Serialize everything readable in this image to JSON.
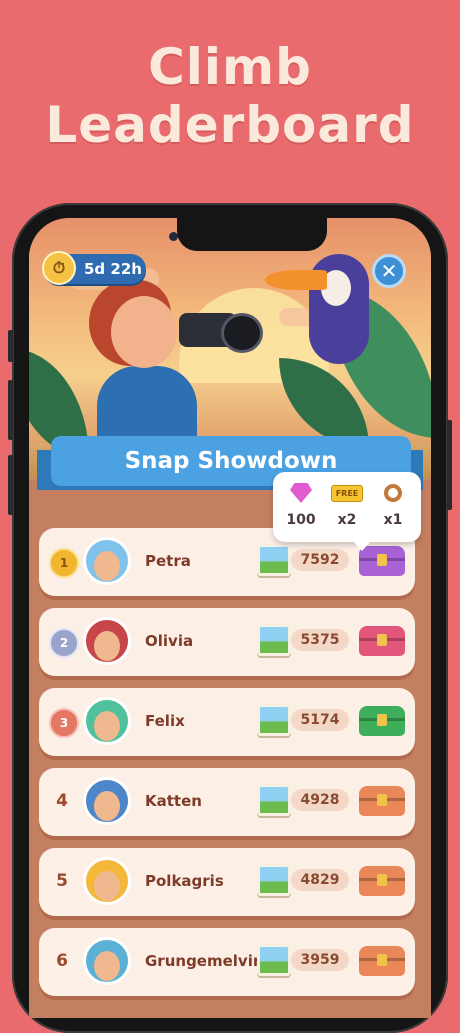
{
  "headline": {
    "line1": "Climb",
    "line2": "Leaderboard"
  },
  "event": {
    "timer": "5d 22h",
    "title": "Snap Showdown",
    "close_label": "✕"
  },
  "rewards": [
    {
      "icon": "gem-icon",
      "value": "100"
    },
    {
      "icon": "free-ticket-icon",
      "badge": "FREE",
      "value": "x2"
    },
    {
      "icon": "ring-icon",
      "value": "x1"
    }
  ],
  "leaderboard": [
    {
      "rank": "1",
      "name": "Petra",
      "score": "7592",
      "medal": "gold",
      "chest": "#a962d6",
      "avatar_bg": "#7fc3ea"
    },
    {
      "rank": "2",
      "name": "Olivia",
      "score": "5375",
      "medal": "silver",
      "chest": "#e2567b",
      "avatar_bg": "#c8454a"
    },
    {
      "rank": "3",
      "name": "Felix",
      "score": "5174",
      "medal": "bronze",
      "chest": "#3fae5a",
      "avatar_bg": "#4fc19c"
    },
    {
      "rank": "4",
      "name": "Katten",
      "score": "4928",
      "medal": "",
      "chest": "#e98758",
      "avatar_bg": "#4d86c9"
    },
    {
      "rank": "5",
      "name": "Polkagris",
      "score": "4829",
      "medal": "",
      "chest": "#e98758",
      "avatar_bg": "#f3b73a"
    },
    {
      "rank": "6",
      "name": "Grungemelvin",
      "score": "3959",
      "medal": "",
      "chest": "#e98758",
      "avatar_bg": "#5bb0d6"
    }
  ],
  "colors": {
    "background": "#ea6b6d",
    "ribbon": "#4ba1e2",
    "board": "#c47f60"
  }
}
